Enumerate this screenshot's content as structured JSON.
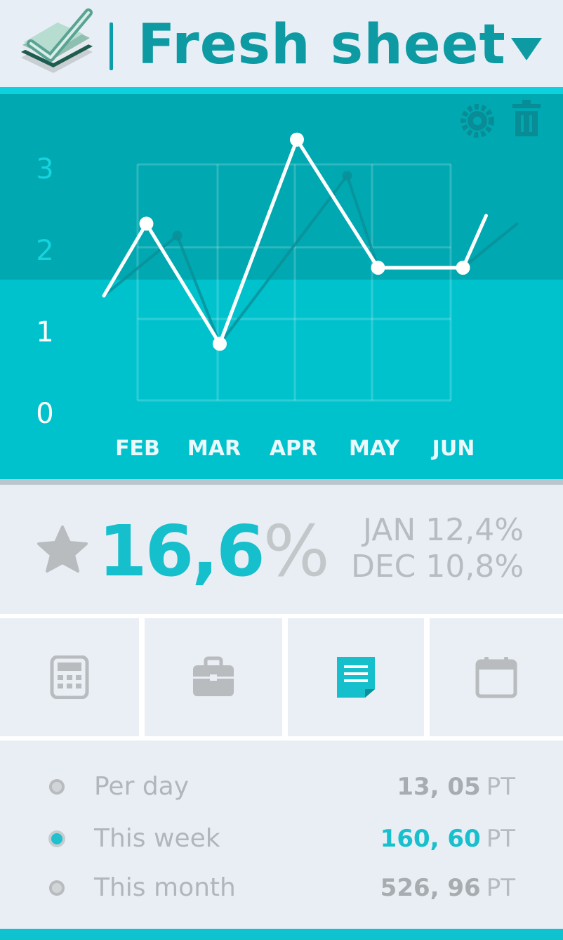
{
  "header": {
    "title": "Fresh sheet",
    "logo_icon": "book-check-icon",
    "menu_icon": "caret-down-icon"
  },
  "chart_toolbar": {
    "settings_icon": "gear-icon",
    "delete_icon": "trash-icon"
  },
  "chart_data": {
    "type": "line",
    "categories": [
      "FEB",
      "MAR",
      "APR",
      "MAY",
      "JUN"
    ],
    "y_ticks": [
      "0",
      "1",
      "2",
      "3"
    ],
    "ylim": [
      0,
      3
    ],
    "grid": true,
    "series": [
      {
        "values": [
          1.0,
          1.9,
          0.4,
          2.95,
          1.35,
          1.35,
          2.0
        ],
        "x": [
          0.0,
          0.55,
          1.5,
          2.5,
          3.55,
          4.65,
          4.95
        ],
        "color": "#ffffff"
      },
      {
        "values": [
          1.0,
          1.75,
          0.4,
          2.5,
          1.35,
          1.35,
          1.9
        ],
        "x": [
          0.0,
          0.95,
          1.5,
          3.15,
          3.55,
          4.65,
          5.35
        ],
        "color": "#0a8f98"
      }
    ]
  },
  "stats": {
    "star_icon": "star-icon",
    "value": "16,6",
    "unit": "%",
    "comparisons": [
      "JAN 12,4%",
      "DEC 10,8%"
    ]
  },
  "tabs": [
    {
      "icon": "calculator-icon",
      "active": false
    },
    {
      "icon": "briefcase-icon",
      "active": false
    },
    {
      "icon": "note-icon",
      "active": true
    },
    {
      "icon": "calendar-icon",
      "active": false
    }
  ],
  "list": [
    {
      "label": "Per day",
      "value": "13, 05",
      "unit": "PT",
      "active": false
    },
    {
      "label": "This week",
      "value": "160, 60",
      "unit": "PT",
      "active": true
    },
    {
      "label": "This month",
      "value": "526, 96",
      "unit": "PT",
      "active": false
    }
  ],
  "colors": {
    "accent": "#00c2cd",
    "accent_dark": "#00a8b1",
    "title": "#0e9aa3",
    "background": "#e9eef5",
    "muted": "#b6bcc1"
  }
}
